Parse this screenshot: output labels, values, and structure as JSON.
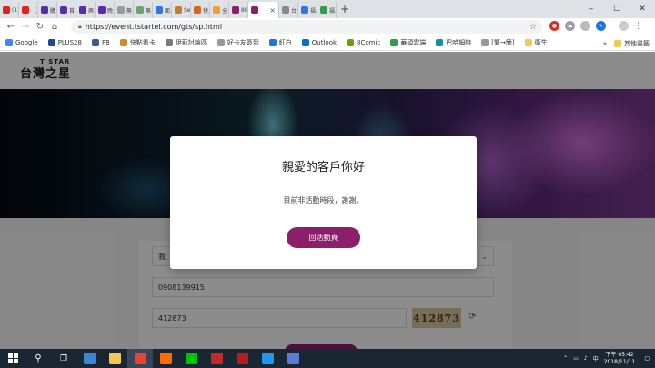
{
  "browser": {
    "tabs": [
      {
        "label": "(1)…",
        "color": "#e62117"
      },
      {
        "label": "【…",
        "color": "#e62117"
      },
      {
        "label": "購…",
        "color": "#5b2bb3"
      },
      {
        "label": "首…",
        "color": "#5b2bb3"
      },
      {
        "label": "興…",
        "color": "#5b2bb3"
      },
      {
        "label": "晚…",
        "color": "#5b2bb3"
      },
      {
        "label": "無…",
        "color": "#999999"
      },
      {
        "label": "無…",
        "color": "#6aa36f"
      },
      {
        "label": "面…",
        "color": "#2a7ae2"
      },
      {
        "label": "Seu",
        "color": "#c67a2b"
      },
      {
        "label": "快…",
        "color": "#d2691e"
      },
      {
        "label": "全…",
        "color": "#f0a030"
      },
      {
        "label": "88",
        "color": "#8b1f6a"
      },
      {
        "label": "",
        "color": "#8b1f6a",
        "active": true
      },
      {
        "label": "台…",
        "color": "#888888"
      },
      {
        "label": "福…",
        "color": "#2a7ae2"
      },
      {
        "label": "福…",
        "color": "#2e9e4a"
      }
    ],
    "new_tab": "+",
    "url": "https://event.tstartel.com/gts/sp.html",
    "window_controls": [
      "–",
      "☐",
      "✕"
    ]
  },
  "bookmarks": {
    "items": [
      {
        "label": "Google",
        "color": "#4285f4"
      },
      {
        "label": "PLUS28",
        "color": "#1e4a8a"
      },
      {
        "label": "FB",
        "color": "#3b5998"
      },
      {
        "label": "快點看卡",
        "color": "#d28a2b"
      },
      {
        "label": "伊莉討論區",
        "color": "#7a7a7a"
      },
      {
        "label": "好卡友簽到",
        "color": "#999999"
      },
      {
        "label": "紅白",
        "color": "#1a73e8"
      },
      {
        "label": "Outlook",
        "color": "#0072c6"
      },
      {
        "label": "8Comic",
        "color": "#6aa300"
      },
      {
        "label": "華碩雲端",
        "color": "#2e9e4a"
      },
      {
        "label": "巴哈姆特",
        "color": "#1a8fa0"
      },
      {
        "label": "[繁→簡]",
        "color": "#999999"
      },
      {
        "label": "衛生",
        "color": "#f2c94c"
      }
    ],
    "more": "»",
    "other": "其他書籤"
  },
  "site": {
    "logo_top": "T STAR",
    "logo_main": "台灣之星"
  },
  "form": {
    "select_value": "我",
    "phone_value": "0908139915",
    "captcha_input_value": "412873",
    "captcha_image_text": "412873"
  },
  "modal": {
    "title": "親愛的客戶你好",
    "message": "目前非活動時段，謝謝。",
    "button_label": "回活動頁"
  },
  "taskbar": {
    "clock_time": "下午 05:42",
    "clock_date": "2018/11/11",
    "apps": [
      "#3b86d4",
      "#f2c94c",
      "#ea4335",
      "#ff6d00",
      "#00c300",
      "#c62828",
      "#b71c1c",
      "#2196f3",
      "#5a7bd4"
    ]
  }
}
